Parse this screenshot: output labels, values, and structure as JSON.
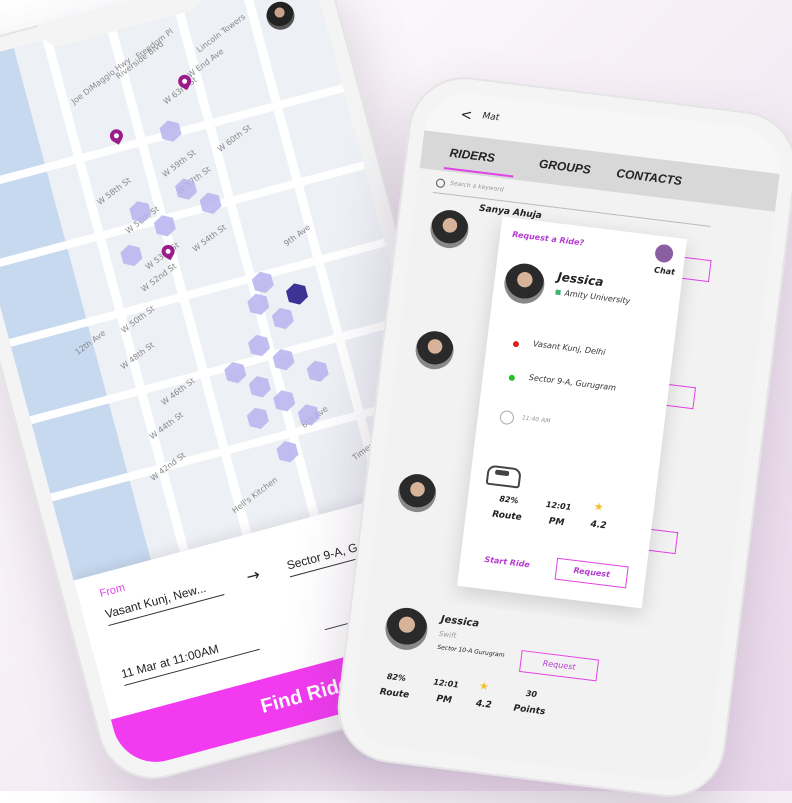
{
  "map_screen": {
    "street_labels": [
      "W 63rd St",
      "W 60th St",
      "W 58th St",
      "W 59th St",
      "W 57th St",
      "W 56th St",
      "W 54th St",
      "W 53rd St",
      "W 52nd St",
      "W 50th St",
      "W 48th St",
      "W 46th St",
      "W 44th St",
      "W 42nd St",
      "W End Ave",
      "Riverside Blvd",
      "Joe DiMaggio Hwy",
      "Freedom Pl",
      "12th Ave",
      "9th Ave",
      "8th Ave",
      "Times Square",
      "Hell's Kitchen",
      "Lincoln Towers"
    ],
    "from_label": "From",
    "from_value": "Vasant Kunj, New...",
    "to_value": "Sector 9-A, G",
    "date_value": "11 Mar at 11:00AM",
    "find_ride_label": "Find Ride",
    "pin_color": "#9c1b8b",
    "accent": "#f23bf0"
  },
  "riders_screen": {
    "title": "Mat",
    "tabs": [
      "RIDERS",
      "GROUPS",
      "CONTACTS"
    ],
    "search_placeholder": "Search a keyword",
    "list": [
      {
        "name": "Sanya Ahuja"
      }
    ],
    "popup": {
      "title": "Request a Ride?",
      "chat_label": "Chat",
      "name": "Jessica",
      "university": "Amity University",
      "pickup": "Vasant Kunj, Delhi",
      "drop": "Sector 9-A, Gurugram",
      "time": "11:40 AM",
      "route_pct": "82%",
      "route_label": "Route",
      "eta": "12:01",
      "eta_label": "PM",
      "rating": "4.2",
      "start_ride_label": "Start Ride",
      "request_label": "Request"
    },
    "bottom_card": {
      "name": "Jessica",
      "car": "Swift",
      "location": "Sector 10-A Gurugram",
      "request_label": "Request",
      "route_pct": "82%",
      "route_label": "Route",
      "eta": "12:01",
      "eta_label": "PM",
      "rating": "4.2",
      "points": "30",
      "points_label": "Points"
    },
    "accent": "#e142e6"
  }
}
